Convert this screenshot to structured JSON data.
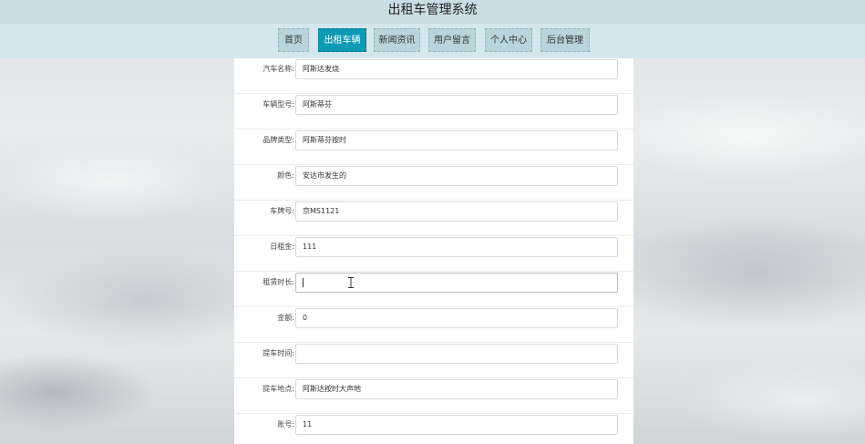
{
  "header": {
    "title": "出租车管理系统"
  },
  "nav": {
    "items": [
      {
        "label": "首页",
        "active": false
      },
      {
        "label": "出租车辆",
        "active": true
      },
      {
        "label": "新闻资讯",
        "active": false
      },
      {
        "label": "用户留言",
        "active": false
      },
      {
        "label": "个人中心",
        "active": false
      },
      {
        "label": "后台管理",
        "active": false
      }
    ]
  },
  "form": {
    "fields": [
      {
        "label": "汽车名称:",
        "value": "阿斯达发烧"
      },
      {
        "label": "车辆型号:",
        "value": "阿斯蒂芬"
      },
      {
        "label": "品牌类型:",
        "value": "阿斯蒂芬按时"
      },
      {
        "label": "颜色:",
        "value": "安达市发生的"
      },
      {
        "label": "车牌号:",
        "value": "京MS1121"
      },
      {
        "label": "日租金:",
        "value": "111"
      },
      {
        "label": "租赁时长:",
        "value": ""
      },
      {
        "label": "金额:",
        "value": "0"
      },
      {
        "label": "提车时间:",
        "value": ""
      },
      {
        "label": "提车地点:",
        "value": "阿斯达按时大声地"
      },
      {
        "label": "账号:",
        "value": "11"
      }
    ]
  },
  "colors": {
    "header_bg": "#c9dde4",
    "nav_bg": "#d5e7ee",
    "nav_item_bg": "#b9d4dc",
    "nav_active_bg": "#0d9ab5"
  }
}
